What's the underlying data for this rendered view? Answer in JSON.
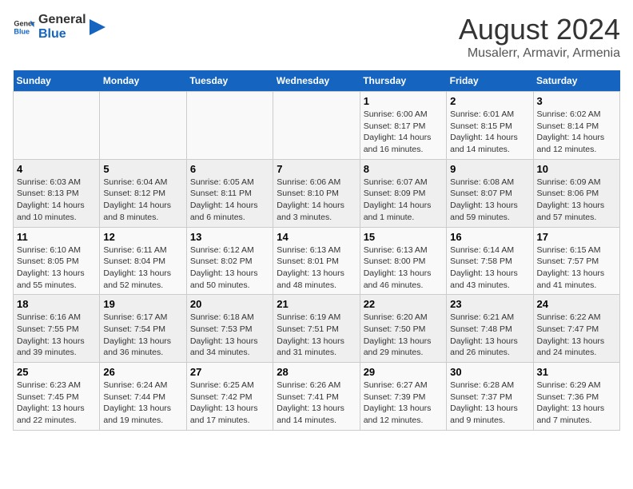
{
  "header": {
    "logo_line1": "General",
    "logo_line2": "Blue",
    "title": "August 2024",
    "subtitle": "Musalerr, Armavir, Armenia"
  },
  "calendar": {
    "days_of_week": [
      "Sunday",
      "Monday",
      "Tuesday",
      "Wednesday",
      "Thursday",
      "Friday",
      "Saturday"
    ],
    "weeks": [
      [
        {
          "day": "",
          "info": ""
        },
        {
          "day": "",
          "info": ""
        },
        {
          "day": "",
          "info": ""
        },
        {
          "day": "",
          "info": ""
        },
        {
          "day": "1",
          "info": "Sunrise: 6:00 AM\nSunset: 8:17 PM\nDaylight: 14 hours\nand 16 minutes."
        },
        {
          "day": "2",
          "info": "Sunrise: 6:01 AM\nSunset: 8:15 PM\nDaylight: 14 hours\nand 14 minutes."
        },
        {
          "day": "3",
          "info": "Sunrise: 6:02 AM\nSunset: 8:14 PM\nDaylight: 14 hours\nand 12 minutes."
        }
      ],
      [
        {
          "day": "4",
          "info": "Sunrise: 6:03 AM\nSunset: 8:13 PM\nDaylight: 14 hours\nand 10 minutes."
        },
        {
          "day": "5",
          "info": "Sunrise: 6:04 AM\nSunset: 8:12 PM\nDaylight: 14 hours\nand 8 minutes."
        },
        {
          "day": "6",
          "info": "Sunrise: 6:05 AM\nSunset: 8:11 PM\nDaylight: 14 hours\nand 6 minutes."
        },
        {
          "day": "7",
          "info": "Sunrise: 6:06 AM\nSunset: 8:10 PM\nDaylight: 14 hours\nand 3 minutes."
        },
        {
          "day": "8",
          "info": "Sunrise: 6:07 AM\nSunset: 8:09 PM\nDaylight: 14 hours\nand 1 minute."
        },
        {
          "day": "9",
          "info": "Sunrise: 6:08 AM\nSunset: 8:07 PM\nDaylight: 13 hours\nand 59 minutes."
        },
        {
          "day": "10",
          "info": "Sunrise: 6:09 AM\nSunset: 8:06 PM\nDaylight: 13 hours\nand 57 minutes."
        }
      ],
      [
        {
          "day": "11",
          "info": "Sunrise: 6:10 AM\nSunset: 8:05 PM\nDaylight: 13 hours\nand 55 minutes."
        },
        {
          "day": "12",
          "info": "Sunrise: 6:11 AM\nSunset: 8:04 PM\nDaylight: 13 hours\nand 52 minutes."
        },
        {
          "day": "13",
          "info": "Sunrise: 6:12 AM\nSunset: 8:02 PM\nDaylight: 13 hours\nand 50 minutes."
        },
        {
          "day": "14",
          "info": "Sunrise: 6:13 AM\nSunset: 8:01 PM\nDaylight: 13 hours\nand 48 minutes."
        },
        {
          "day": "15",
          "info": "Sunrise: 6:13 AM\nSunset: 8:00 PM\nDaylight: 13 hours\nand 46 minutes."
        },
        {
          "day": "16",
          "info": "Sunrise: 6:14 AM\nSunset: 7:58 PM\nDaylight: 13 hours\nand 43 minutes."
        },
        {
          "day": "17",
          "info": "Sunrise: 6:15 AM\nSunset: 7:57 PM\nDaylight: 13 hours\nand 41 minutes."
        }
      ],
      [
        {
          "day": "18",
          "info": "Sunrise: 6:16 AM\nSunset: 7:55 PM\nDaylight: 13 hours\nand 39 minutes."
        },
        {
          "day": "19",
          "info": "Sunrise: 6:17 AM\nSunset: 7:54 PM\nDaylight: 13 hours\nand 36 minutes."
        },
        {
          "day": "20",
          "info": "Sunrise: 6:18 AM\nSunset: 7:53 PM\nDaylight: 13 hours\nand 34 minutes."
        },
        {
          "day": "21",
          "info": "Sunrise: 6:19 AM\nSunset: 7:51 PM\nDaylight: 13 hours\nand 31 minutes."
        },
        {
          "day": "22",
          "info": "Sunrise: 6:20 AM\nSunset: 7:50 PM\nDaylight: 13 hours\nand 29 minutes."
        },
        {
          "day": "23",
          "info": "Sunrise: 6:21 AM\nSunset: 7:48 PM\nDaylight: 13 hours\nand 26 minutes."
        },
        {
          "day": "24",
          "info": "Sunrise: 6:22 AM\nSunset: 7:47 PM\nDaylight: 13 hours\nand 24 minutes."
        }
      ],
      [
        {
          "day": "25",
          "info": "Sunrise: 6:23 AM\nSunset: 7:45 PM\nDaylight: 13 hours\nand 22 minutes."
        },
        {
          "day": "26",
          "info": "Sunrise: 6:24 AM\nSunset: 7:44 PM\nDaylight: 13 hours\nand 19 minutes."
        },
        {
          "day": "27",
          "info": "Sunrise: 6:25 AM\nSunset: 7:42 PM\nDaylight: 13 hours\nand 17 minutes."
        },
        {
          "day": "28",
          "info": "Sunrise: 6:26 AM\nSunset: 7:41 PM\nDaylight: 13 hours\nand 14 minutes."
        },
        {
          "day": "29",
          "info": "Sunrise: 6:27 AM\nSunset: 7:39 PM\nDaylight: 13 hours\nand 12 minutes."
        },
        {
          "day": "30",
          "info": "Sunrise: 6:28 AM\nSunset: 7:37 PM\nDaylight: 13 hours\nand 9 minutes."
        },
        {
          "day": "31",
          "info": "Sunrise: 6:29 AM\nSunset: 7:36 PM\nDaylight: 13 hours\nand 7 minutes."
        }
      ]
    ]
  }
}
